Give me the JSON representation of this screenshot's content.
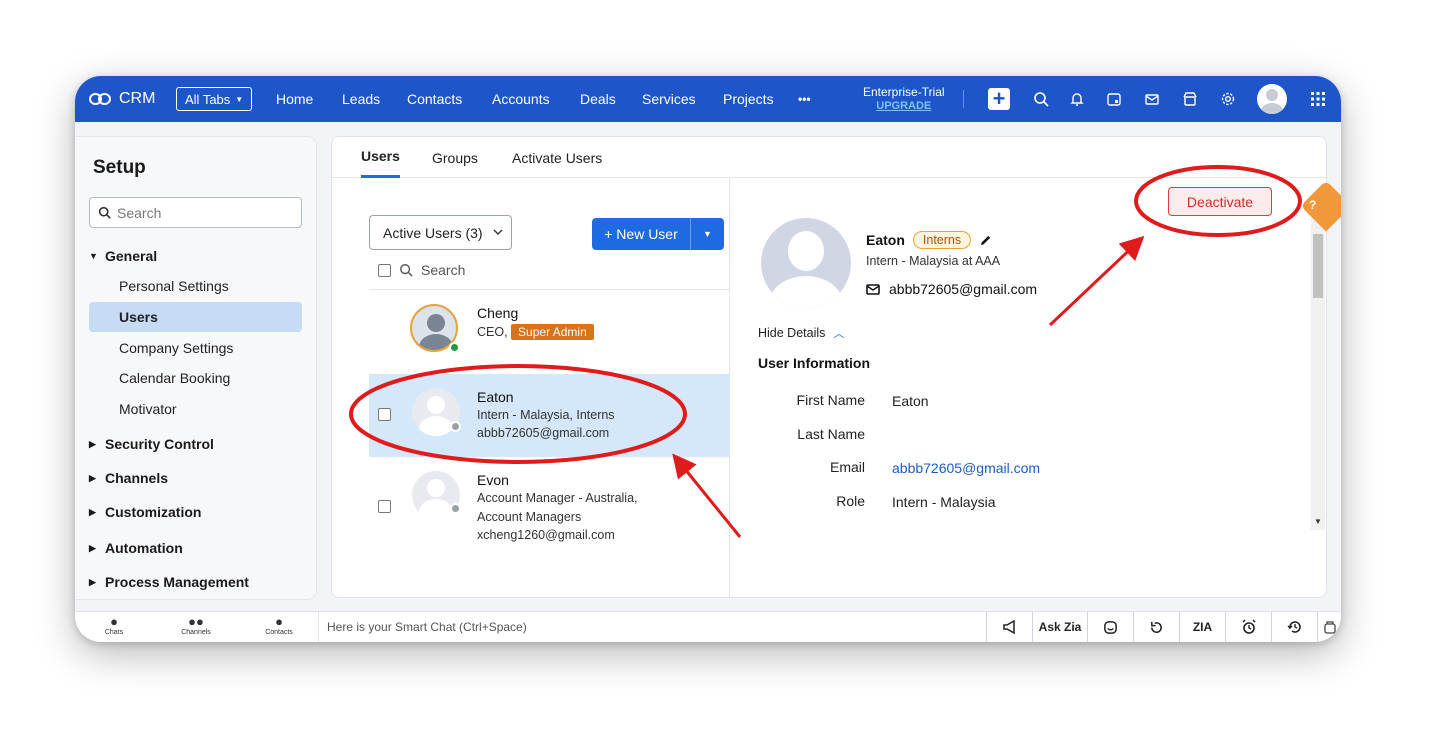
{
  "topbar": {
    "brand": "CRM",
    "all_tabs": "All Tabs",
    "nav": [
      "Home",
      "Leads",
      "Contacts",
      "Accounts",
      "Deals",
      "Services",
      "Projects"
    ],
    "more": "•••",
    "plan": "Enterprise-Trial",
    "upgrade": "UPGRADE",
    "icons": [
      "plus-icon",
      "search-icon",
      "bell-icon",
      "calendar-icon",
      "mail-icon",
      "marketplace-icon",
      "gear-icon",
      "avatar",
      "apps-grid-icon"
    ]
  },
  "sidebar": {
    "title": "Setup",
    "search_placeholder": "Search",
    "general": "General",
    "general_items": [
      "Personal Settings",
      "Users",
      "Company Settings",
      "Calendar Booking",
      "Motivator"
    ],
    "sections": [
      "Security Control",
      "Channels",
      "Customization",
      "Automation",
      "Process Management"
    ]
  },
  "tabs": [
    "Users",
    "Groups",
    "Activate Users"
  ],
  "list": {
    "filter": "Active Users (3)",
    "new_user": "+ New User",
    "search": "Search",
    "users": [
      {
        "name": "Cheng",
        "line1": "CEO,",
        "badge": "Super Admin",
        "status": "online"
      },
      {
        "name": "Eaton",
        "line1": "Intern - Malaysia, Interns",
        "line2": "abbb72605@gmail.com",
        "status": "offline"
      },
      {
        "name": "Evon",
        "line1": "Account Manager - Australia,",
        "line2": "Account Managers",
        "line3": "xcheng1260@gmail.com",
        "status": "offline"
      }
    ]
  },
  "detail": {
    "deactivate": "Deactivate",
    "name": "Eaton",
    "profile_badge": "Interns",
    "role_line": "Intern - Malaysia  at  AAA",
    "email": "abbb72605@gmail.com",
    "hide_details": "Hide Details",
    "section_title": "User Information",
    "fields": [
      {
        "label": "First Name",
        "value": "Eaton"
      },
      {
        "label": "Last Name",
        "value": ""
      },
      {
        "label": "Email",
        "value": "abbb72605@gmail.com"
      },
      {
        "label": "Role",
        "value": "Intern - Malaysia"
      }
    ]
  },
  "help": "?",
  "bottombar": {
    "items": [
      "Chats",
      "Channels",
      "Contacts"
    ],
    "smartchat": "Here is your Smart Chat (Ctrl+Space)",
    "ask_zia": "Ask Zia"
  },
  "colors": {
    "brand": "#1e56c9",
    "accent": "#1e6ae0",
    "annotation": "#e01b1b",
    "selected_row": "#d4e7fb"
  }
}
